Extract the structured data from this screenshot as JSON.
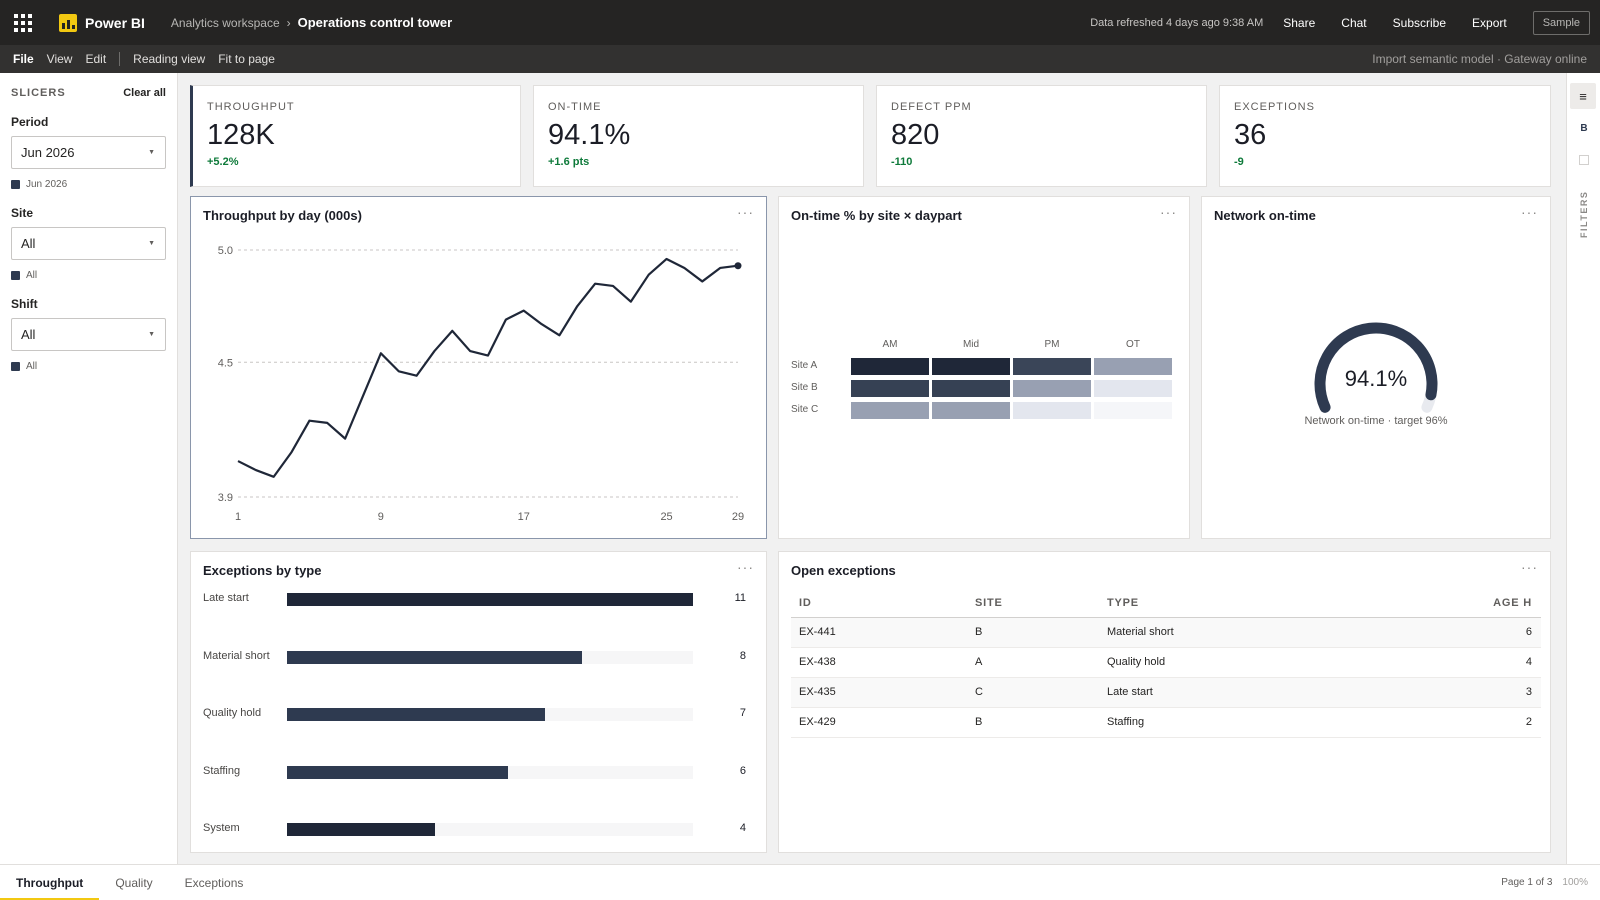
{
  "topbar": {
    "app_name": "Power BI",
    "workspace": "Analytics workspace",
    "separator": "›",
    "report_title": "Operations control tower",
    "refreshed": "Data refreshed 4 days ago 9:38 AM",
    "actions": [
      "Share",
      "Chat",
      "Subscribe",
      "Export"
    ],
    "sample_label": "Sample"
  },
  "menubar": {
    "items": [
      "File",
      "View",
      "Edit"
    ],
    "view_items": [
      "Reading view",
      "Fit to page"
    ],
    "status": "Import semantic model · Gateway online"
  },
  "slicers": {
    "title": "SLICERS",
    "clear_label": "Clear all",
    "items": [
      {
        "label": "Period",
        "value": "Jun 2026",
        "chip": "Jun 2026"
      },
      {
        "label": "Site",
        "value": "All",
        "chip": "All"
      },
      {
        "label": "Shift",
        "value": "All",
        "chip": "All"
      }
    ]
  },
  "filters_pane": {
    "toggle_icon": "≡",
    "b_label": "B",
    "filters_label": "FILTERS"
  },
  "kpis": [
    {
      "label": "THROUGHPUT",
      "value": "128K",
      "delta": "+5.2%"
    },
    {
      "label": "ON-TIME",
      "value": "94.1%",
      "delta": "+1.6 pts"
    },
    {
      "label": "DEFECT PPM",
      "value": "820",
      "delta": "-110"
    },
    {
      "label": "EXCEPTIONS",
      "value": "36",
      "delta": "-9"
    }
  ],
  "visuals": {
    "line_title": "Throughput by day (000s)",
    "heatmap_title": "On-time % by site × daypart",
    "gauge_title": "Network on-time",
    "bars_title": "Exceptions by type",
    "table_title": "Open exceptions",
    "more_label": "···"
  },
  "gauge": {
    "value": 94.1,
    "display": "94.1%",
    "caption": "Network on-time · target 96%"
  },
  "table": {
    "columns": [
      "ID",
      "SITE",
      "TYPE",
      "AGE H"
    ],
    "rows": [
      [
        "EX-441",
        "B",
        "Material short",
        "6"
      ],
      [
        "EX-438",
        "A",
        "Quality hold",
        "4"
      ],
      [
        "EX-435",
        "C",
        "Late start",
        "3"
      ],
      [
        "EX-429",
        "B",
        "Staffing",
        "2"
      ]
    ]
  },
  "tabs": {
    "items": [
      "Throughput",
      "Quality",
      "Exceptions"
    ],
    "active": 0,
    "page_info": "Page 1 of 3",
    "zoom": "100%"
  },
  "colors": {
    "accent": "#f2c811",
    "navy": "#2e3a50",
    "positive": "#0e7a3a"
  },
  "chart_data": [
    {
      "type": "line",
      "title": "Throughput by day (000s)",
      "x": [
        1,
        2,
        3,
        4,
        5,
        6,
        7,
        8,
        9,
        10,
        11,
        12,
        13,
        14,
        15,
        16,
        17,
        18,
        19,
        20,
        21,
        22,
        23,
        24,
        25,
        26,
        27,
        28,
        29
      ],
      "x_ticks": [
        1,
        9,
        17,
        25,
        29
      ],
      "y_ticks": [
        3.9,
        4.5,
        5.0
      ],
      "ylim": [
        3.9,
        5.0
      ],
      "series": [
        {
          "values": [
            4.06,
            4.02,
            3.99,
            4.1,
            4.24,
            4.23,
            4.16,
            4.35,
            4.54,
            4.46,
            4.44,
            4.55,
            4.64,
            4.55,
            4.53,
            4.69,
            4.73,
            4.67,
            4.62,
            4.75,
            4.85,
            4.84,
            4.77,
            4.89,
            4.96,
            4.92,
            4.86,
            4.92,
            4.93
          ]
        }
      ],
      "grid": true
    },
    {
      "type": "heatmap",
      "title": "On-time % by site × daypart",
      "x_categories": [
        "AM",
        "Mid",
        "PM",
        "OT"
      ],
      "y_categories": [
        "Site A",
        "Site B",
        "Site C"
      ],
      "values": [
        [
          0.98,
          0.97,
          0.85,
          0.5
        ],
        [
          0.9,
          0.92,
          0.5,
          0.12
        ],
        [
          0.5,
          0.5,
          0.12,
          0.03
        ]
      ],
      "colors": [
        [
          "#1f2738",
          "#1f2738",
          "#3a4558",
          "#98a0b2"
        ],
        [
          "#364154",
          "#364154",
          "#98a0b2",
          "#e3e6ee"
        ],
        [
          "#98a0b2",
          "#98a0b2",
          "#e3e6ee",
          "#f5f6f9"
        ]
      ]
    },
    {
      "type": "bar",
      "title": "Exceptions by type",
      "categories": [
        "Late start",
        "Material short",
        "Quality hold",
        "Staffing",
        "System"
      ],
      "values": [
        11,
        8,
        7,
        6,
        4
      ],
      "xlim": [
        0,
        11
      ]
    }
  ]
}
